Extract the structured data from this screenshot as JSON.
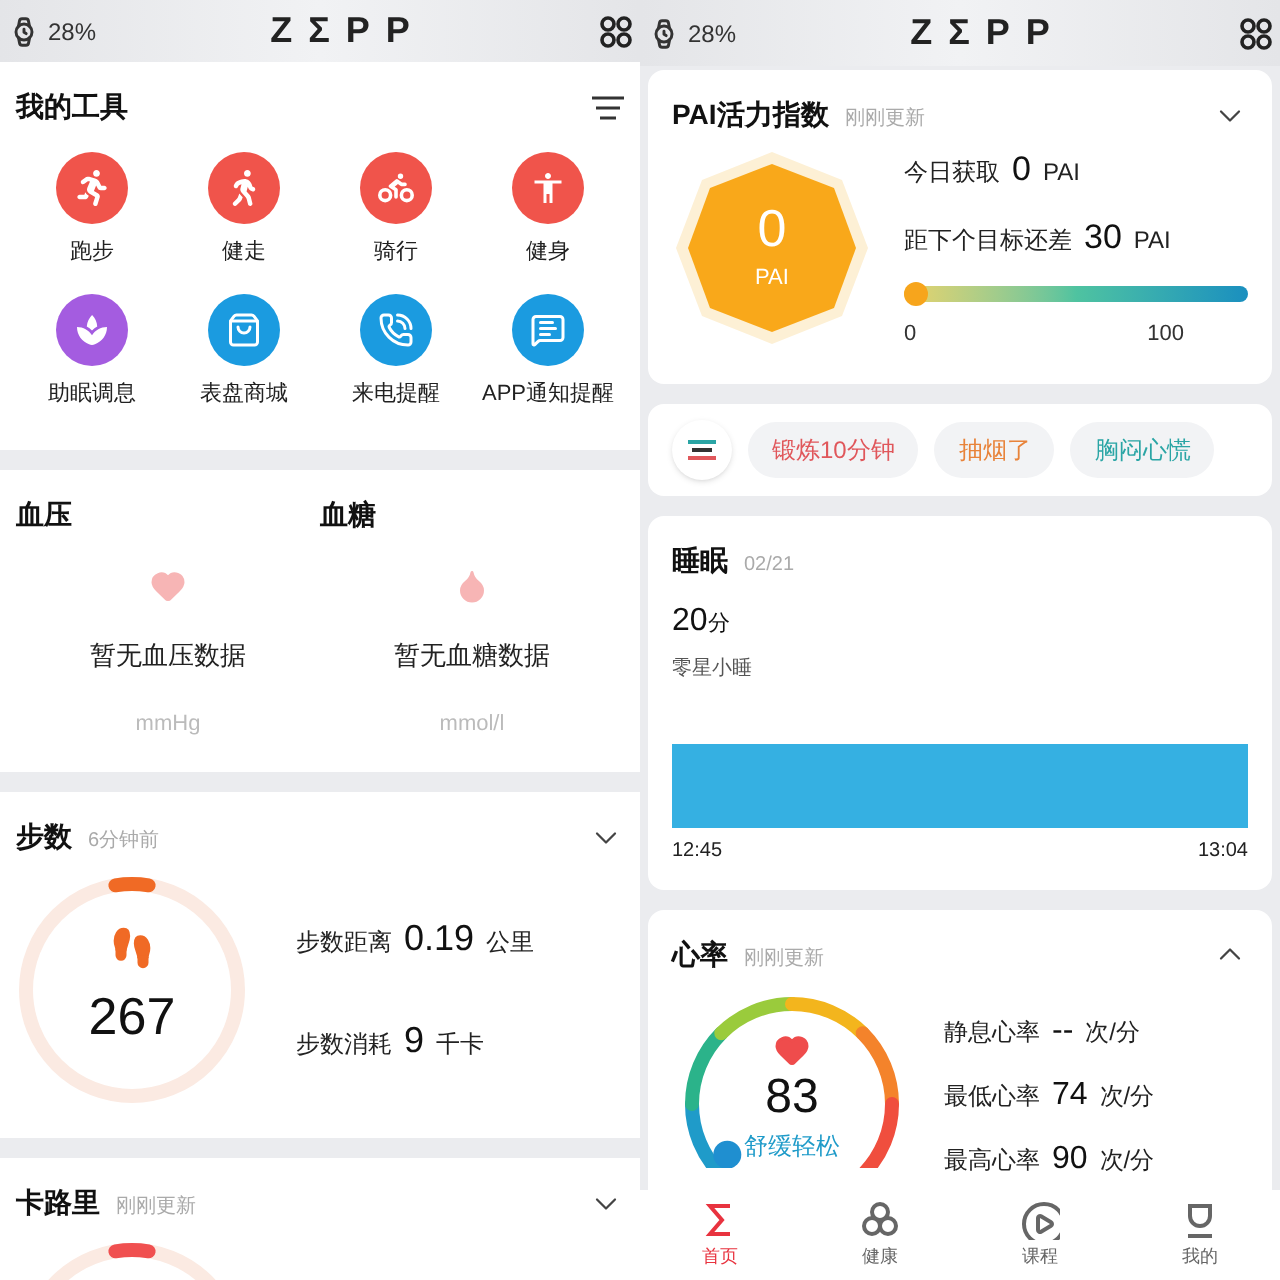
{
  "left_screen": {
    "header": {
      "battery": "28%",
      "logo": "ZΣPP"
    },
    "tools": {
      "title": "我的工具",
      "items": [
        {
          "label": "跑步",
          "color": "#f0544b"
        },
        {
          "label": "健走",
          "color": "#f0544b"
        },
        {
          "label": "骑行",
          "color": "#f0544b"
        },
        {
          "label": "健身",
          "color": "#f0544b"
        },
        {
          "label": "助眠调息",
          "color": "#a45ce0"
        },
        {
          "label": "表盘商城",
          "color": "#1b9be0"
        },
        {
          "label": "来电提醒",
          "color": "#1b9be0"
        },
        {
          "label": "APP通知提醒",
          "color": "#1b9be0"
        }
      ]
    },
    "health": [
      {
        "title": "血压",
        "message": "暂无血压数据",
        "unit": "mmHg"
      },
      {
        "title": "血糖",
        "message": "暂无血糖数据",
        "unit": "mmol/l"
      }
    ],
    "steps": {
      "title": "步数",
      "updated": "6分钟前",
      "expanded": false,
      "level": 0.05,
      "value": "267",
      "stats": [
        {
          "label": "步数距离",
          "value": "0.19",
          "unit": "公里"
        },
        {
          "label": "步数消耗",
          "value": "9",
          "unit": "千卡"
        }
      ]
    },
    "calories": {
      "title": "卡路里",
      "updated": "刚刚更新",
      "expanded": false,
      "level": 0.05
    }
  },
  "right_screen": {
    "header": {
      "battery": "28%",
      "logo": "ZΣPP"
    },
    "pai": {
      "title": "PAI活力指数",
      "updated": "刚刚更新",
      "expanded": false,
      "value": "0",
      "unit": "PAI",
      "stats": [
        {
          "label": "今日获取",
          "value": "0",
          "unit": "PAI"
        },
        {
          "label": "距下个目标还差",
          "value": "30",
          "unit": "PAI"
        }
      ],
      "level": 0,
      "scale_min": "0",
      "scale_max": "100"
    },
    "tags": [
      {
        "label": "锻炼10分钟",
        "color": "#e0575b"
      },
      {
        "label": "抽烟了",
        "color": "#e8833a"
      },
      {
        "label": "胸闷心慌",
        "color": "#2aa5a5"
      }
    ],
    "sleep": {
      "title": "睡眠",
      "date": "02/21",
      "value": "20",
      "unit": "分",
      "type": "零星小睡",
      "start": "12:45",
      "end": "13:04"
    },
    "heart": {
      "title": "心率",
      "updated": "刚刚更新",
      "expanded": true,
      "value": "83",
      "status": "舒缓轻松",
      "stats": [
        {
          "label": "静息心率",
          "value": "--",
          "unit": "次/分"
        },
        {
          "label": "最低心率",
          "value": "74",
          "unit": "次/分"
        },
        {
          "label": "最高心率",
          "value": "90",
          "unit": "次/分"
        }
      ]
    },
    "tabs": [
      {
        "label": "首页",
        "selected": true
      },
      {
        "label": "健康",
        "selected": false
      },
      {
        "label": "课程",
        "selected": false
      },
      {
        "label": "我的",
        "selected": false
      }
    ]
  }
}
